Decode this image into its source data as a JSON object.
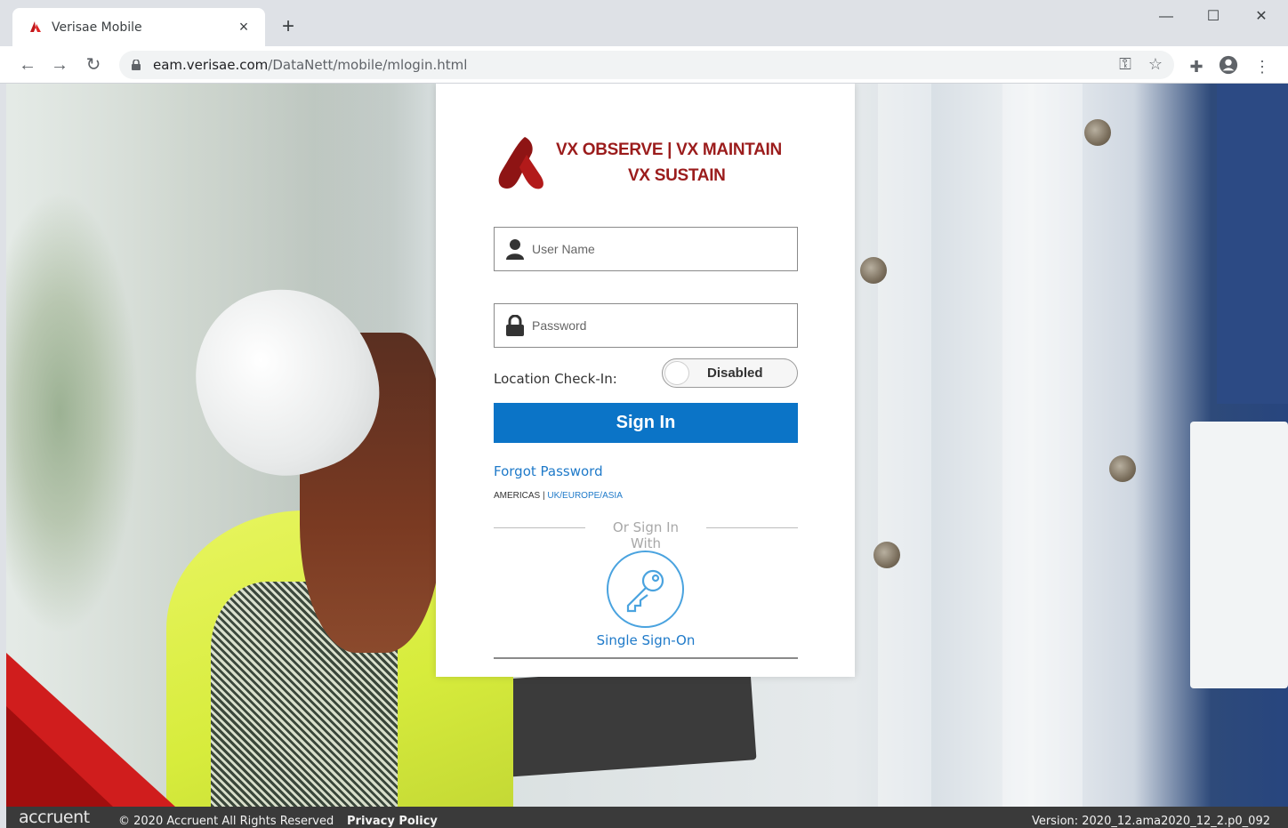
{
  "browser": {
    "tab_title": "Verisae Mobile",
    "tab_close": "×",
    "new_tab": "+",
    "url_host": "eam.verisae.com",
    "url_path": "/DataNett/mobile/mlogin.html",
    "window_controls": {
      "minimize": "—",
      "maximize": "☐",
      "close": "✕"
    }
  },
  "brand": {
    "line1": "VX OBSERVE  |  VX MAINTAIN",
    "line2": "VX SUSTAIN",
    "color": "#9b1c1c"
  },
  "form": {
    "username_placeholder": "User Name",
    "password_placeholder": "Password",
    "location_label": "Location Check-In:",
    "location_toggle": "Disabled",
    "signin_label": "Sign In",
    "forgot_label": "Forgot Password",
    "region_current": "AMERICAS | ",
    "region_link": "UK/EUROPE/ASIA",
    "or_text": "Or Sign In With",
    "sso_label": "Single Sign-On",
    "signin_color": "#0b74c7"
  },
  "footer": {
    "logo": "accruent",
    "copyright": "© 2020 Accruent All Rights Reserved",
    "privacy": "Privacy Policy",
    "version": "Version: 2020_12.ama2020_12_2.p0_092"
  }
}
